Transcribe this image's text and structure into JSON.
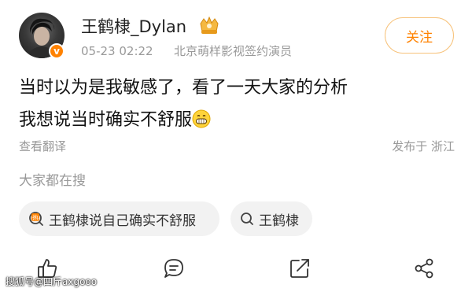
{
  "user": {
    "name": "王鹤棣_Dylan",
    "time": "05-23 02:22",
    "title": "北京萌样影视签约演员",
    "follow_label": "关注",
    "verified_mark": "v"
  },
  "post": {
    "line1": "当时以为是我敏感了，看了一天大家的分析",
    "line2": "我想说当时确实不舒服",
    "translate": "查看翻译",
    "location": "发布于 浙江"
  },
  "search": {
    "heading": "大家都在搜",
    "chips": [
      {
        "label": "王鹤棣说自己确实不舒服",
        "icon": "hot-search-icon",
        "badge": "热"
      },
      {
        "label": "王鹤棣",
        "icon": "search-icon"
      }
    ]
  },
  "actions": [
    {
      "icon": "like-icon"
    },
    {
      "icon": "comment-icon"
    },
    {
      "icon": "repost-icon"
    },
    {
      "icon": "share-icon"
    }
  ],
  "watermark": "搜狐号@四斤axgooo",
  "colors": {
    "accent": "#ff8200",
    "muted": "#999999",
    "chip_bg": "#f2f2f2"
  }
}
